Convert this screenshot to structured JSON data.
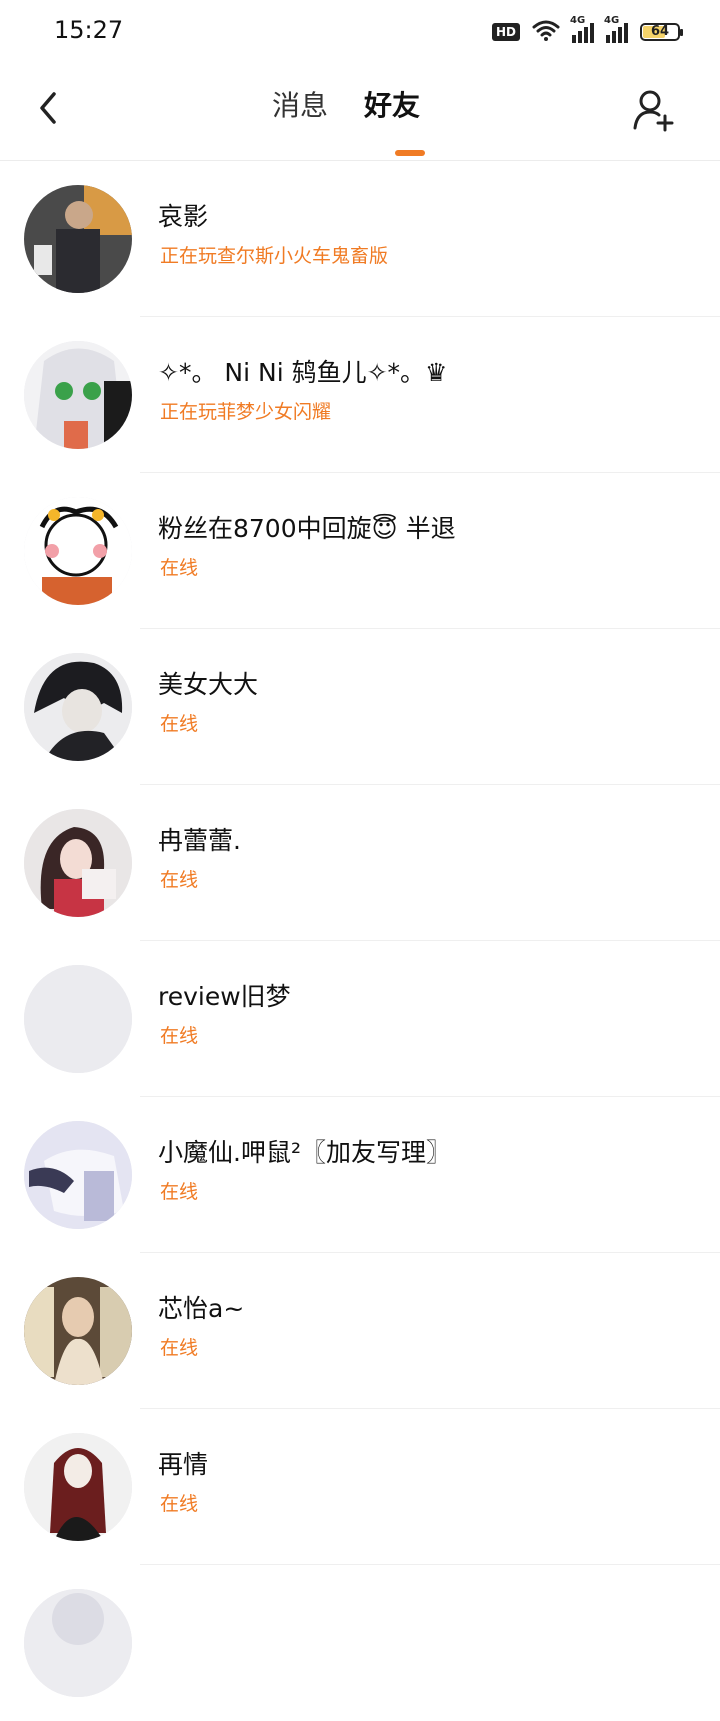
{
  "status_bar": {
    "time": "15:27",
    "hd_label": "HD",
    "network_1": "4G",
    "network_2": "4G",
    "battery_level": "64",
    "battery_fraction": 0.64
  },
  "header": {
    "tabs": [
      {
        "label": "消息",
        "active": false
      },
      {
        "label": "好友",
        "active": true
      }
    ],
    "accent_color": "#f07b24",
    "back_icon": "chevron-left-icon",
    "add_friend_icon": "add-user-icon"
  },
  "friends": [
    {
      "name": "哀影",
      "status": "正在玩查尔斯小火车鬼畜版"
    },
    {
      "name": "✧*。 Ni Ni 鸫鱼儿✧*。♛",
      "status": "正在玩菲梦少女闪耀"
    },
    {
      "name": "粉丝在8700中回旋😇  半退",
      "status": "在线"
    },
    {
      "name": "美女大大",
      "status": "在线"
    },
    {
      "name": "冉蕾蕾.",
      "status": "在线"
    },
    {
      "name": "review旧梦",
      "status": "在线"
    },
    {
      "name": "小魔仙.呷鼠²〖加友写理〗",
      "status": "在线"
    },
    {
      "name": "芯怡a~",
      "status": "在线"
    },
    {
      "name": "再情",
      "status": "在线"
    }
  ]
}
